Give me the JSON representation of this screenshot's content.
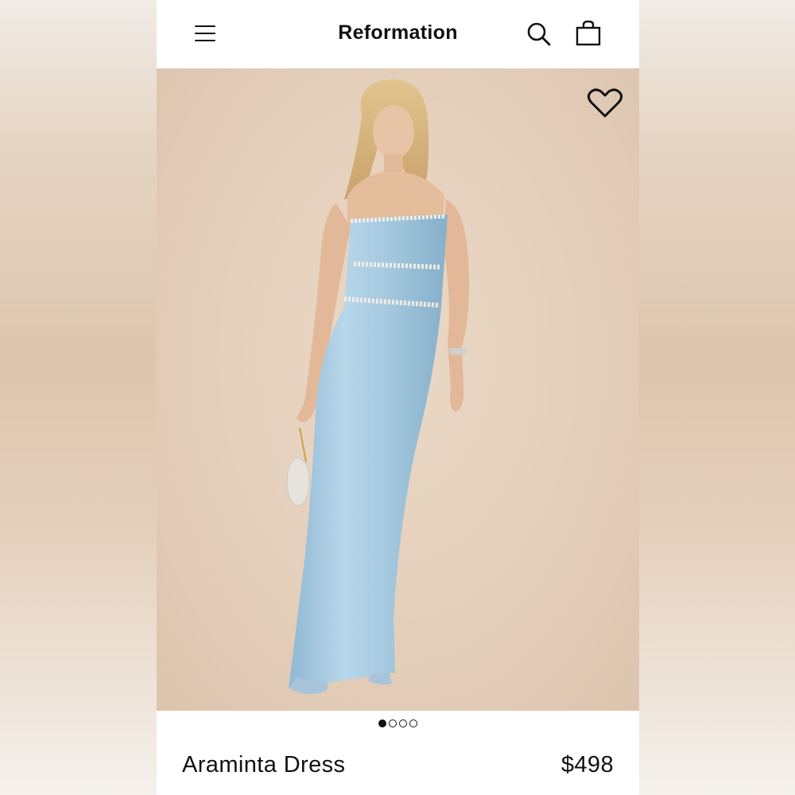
{
  "header": {
    "brand": "Reformation",
    "menu_icon": "hamburger-menu-icon",
    "search_icon": "search-icon",
    "bag_icon": "shopping-bag-icon"
  },
  "hero": {
    "wishlist_icon": "heart-icon",
    "dress_color": "#a9cbe0",
    "background_color": "#e4cfbb"
  },
  "carousel": {
    "total": 4,
    "active_index": 0
  },
  "product": {
    "name": "Araminta Dress",
    "price": "$498"
  }
}
